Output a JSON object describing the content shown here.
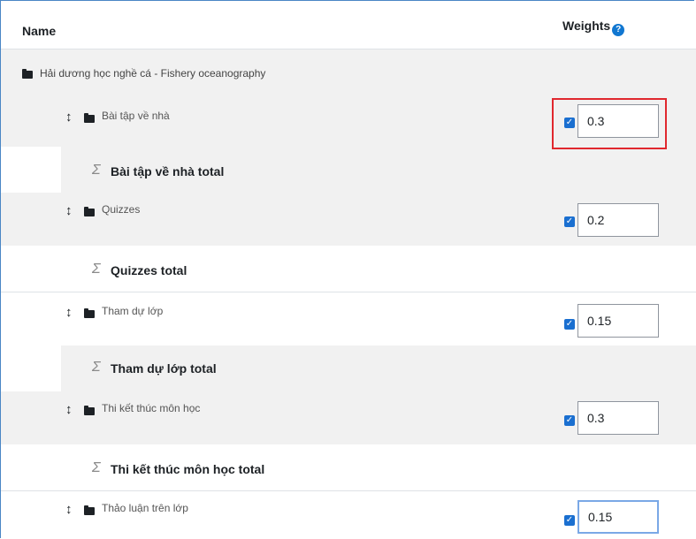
{
  "table": {
    "col_name": "Name",
    "col_weights": "Weights",
    "help_icon": "help-circle-icon"
  },
  "category": {
    "label": "Hải dương học nghề cá - Fishery oceanography"
  },
  "items": [
    {
      "label": "Bài tập về nhà",
      "weight": "0.3",
      "checked": true,
      "total_label": "Bài tập về nhà total"
    },
    {
      "label": "Quizzes",
      "weight": "0.2",
      "checked": true,
      "total_label": "Quizzes total"
    },
    {
      "label": "Tham dự lớp",
      "weight": "0.15",
      "checked": true,
      "total_label": "Tham dự lớp total"
    },
    {
      "label": "Thi kết thúc môn học",
      "weight": "0.3",
      "checked": true,
      "total_label": "Thi kết thúc môn học total"
    },
    {
      "label": "Thảo luận trên lớp",
      "weight": "0.15",
      "checked": true
    }
  ],
  "colors": {
    "accent": "#1a6fd0",
    "highlight": "#e0282e",
    "row_shade": "#f1f1f1"
  }
}
